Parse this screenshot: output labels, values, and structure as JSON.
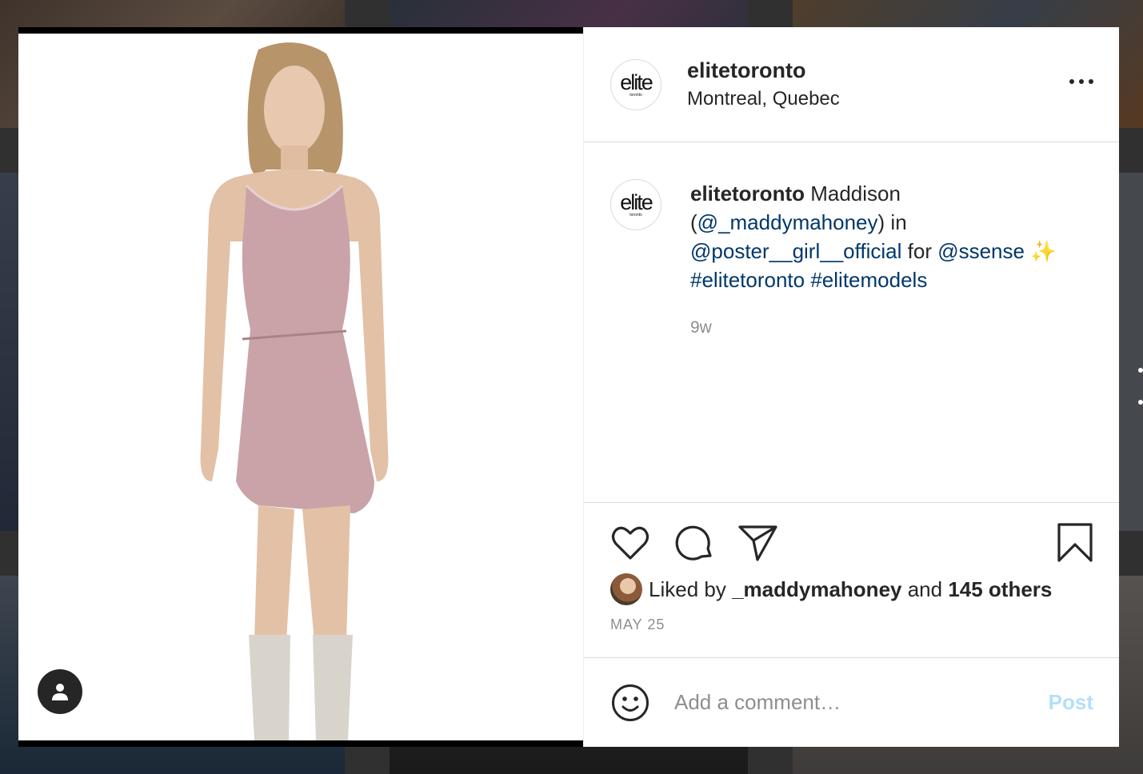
{
  "post": {
    "username": "elitetoronto",
    "location": "Montreal, Quebec",
    "logo_word": "elite",
    "logo_sub": "toronto"
  },
  "caption": {
    "username": "elitetoronto",
    "text_1": " Maddison (",
    "mention_1": "@_maddymahoney",
    "text_2": ") in ",
    "mention_2": "@poster__girl__official",
    "text_3": " for ",
    "mention_3": "@ssense",
    "sparkle": " ✨",
    "hashtag_1": "#elitetoronto",
    "hashtag_2": "#elitemodels",
    "time_ago": "9w"
  },
  "actions": {
    "like_icon": "heart-icon",
    "comment_icon": "comment-icon",
    "share_icon": "paper-plane-icon",
    "save_icon": "bookmark-icon",
    "liked_by_prefix": "Liked by ",
    "liked_by_user": "_maddymahoney",
    "liked_by_and": " and ",
    "liked_by_others": "145 others",
    "date": "MAY 25"
  },
  "comment_box": {
    "placeholder": "Add a comment…",
    "post_label": "Post",
    "emoji_icon": "smiley-icon"
  },
  "media": {
    "user_tag_icon": "person-icon"
  },
  "colors": {
    "text": "#262626",
    "secondary": "#8e8e8e",
    "link": "#00376b",
    "post_disabled": "#b2dffc",
    "dress": "#c9a3a8"
  }
}
